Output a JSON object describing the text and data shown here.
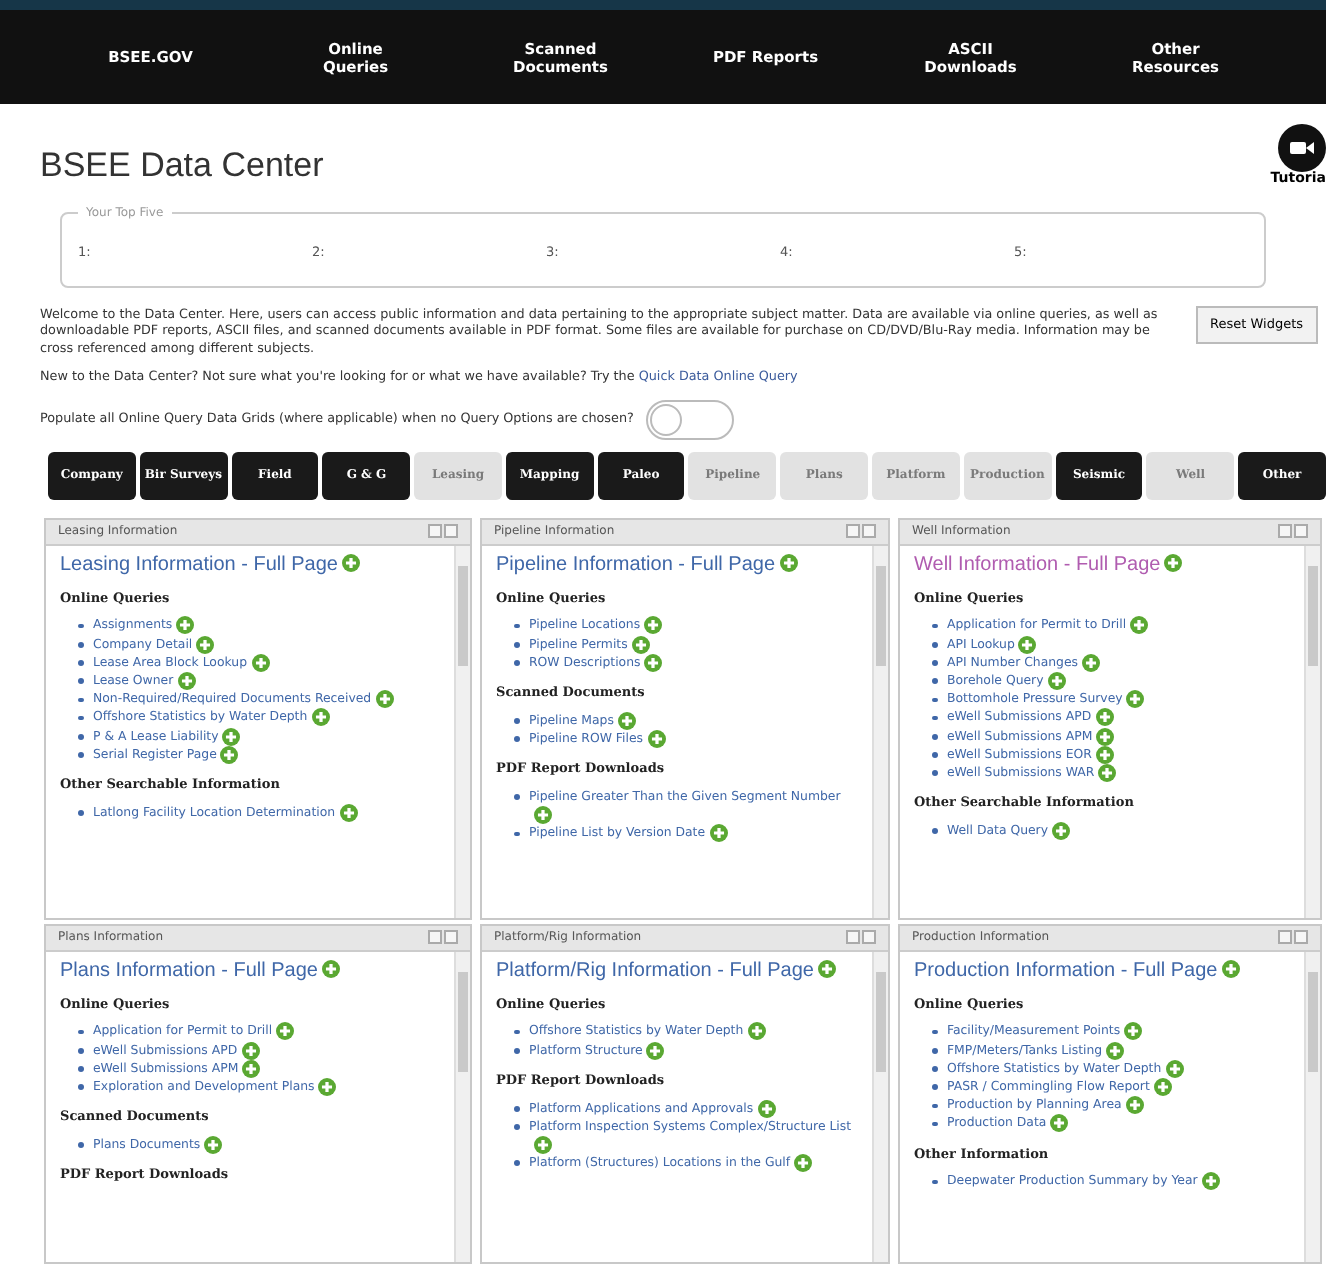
{
  "nav": [
    "BSEE.GOV",
    "Online Queries",
    "Scanned Documents",
    "PDF Reports",
    "ASCII Downloads",
    "Other Resources"
  ],
  "title": "BSEE Data Center",
  "tutorial": "Tutoria",
  "top_five": {
    "legend": "Your Top Five",
    "slots": [
      "1:",
      "2:",
      "3:",
      "4:",
      "5:"
    ]
  },
  "welcome": "Welcome to the Data Center. Here, users can access public information and data pertaining to the appropriate subject matter. Data are available via online queries, as well as downloadable PDF reports, ASCII files, and scanned documents available in PDF format. Some files are available for purchase on CD/DVD/Blu-Ray media. Information may be cross referenced among different subjects.",
  "reset_button": "Reset Widgets",
  "new_prompt": "New to the Data Center? Not sure what you're looking for or what we have available? Try the",
  "quick_link": "Quick Data Online Query",
  "populate": {
    "label": "Populate all Online Query Data Grids (where applicable) when no Query Options are chosen?",
    "on": false
  },
  "filters": [
    {
      "label": "Company",
      "disabled": false
    },
    {
      "label": "Bir Surveys",
      "disabled": false
    },
    {
      "label": "Field",
      "disabled": false
    },
    {
      "label": "G & G",
      "disabled": false
    },
    {
      "label": "Leasing",
      "disabled": true
    },
    {
      "label": "Mapping",
      "disabled": false
    },
    {
      "label": "Paleo",
      "disabled": false
    },
    {
      "label": "Pipeline",
      "disabled": true
    },
    {
      "label": "Plans",
      "disabled": true
    },
    {
      "label": "Platform",
      "disabled": true
    },
    {
      "label": "Production",
      "disabled": true
    },
    {
      "label": "Seismic",
      "disabled": false
    },
    {
      "label": "Well",
      "disabled": true
    },
    {
      "label": "Other",
      "disabled": false
    }
  ],
  "panels": [
    {
      "header": "Leasing Information",
      "full_page": "Leasing Information - Full Page",
      "selected": false,
      "sections": [
        {
          "heading": "Online Queries",
          "items": [
            "Assignments",
            "Company Detail",
            "Lease Area Block Lookup",
            "Lease Owner",
            "Non-Required/Required Documents Received",
            "Offshore Statistics by Water Depth",
            "P & A Lease Liability",
            "Serial Register Page"
          ]
        },
        {
          "heading": "Other Searchable Information",
          "items": [
            "Latlong Facility Location Determination"
          ]
        }
      ]
    },
    {
      "header": "Pipeline Information",
      "full_page": "Pipeline Information - Full Page",
      "selected": false,
      "sections": [
        {
          "heading": "Online Queries",
          "items": [
            "Pipeline Locations",
            "Pipeline Permits",
            "ROW Descriptions"
          ]
        },
        {
          "heading": "Scanned Documents",
          "items": [
            "Pipeline Maps",
            "Pipeline ROW Files"
          ]
        },
        {
          "heading": "PDF Report Downloads",
          "items": [
            "Pipeline Greater Than the Given Segment Number",
            "Pipeline List by Version Date"
          ]
        }
      ]
    },
    {
      "header": "Well Information",
      "full_page": "Well Information - Full Page",
      "selected": true,
      "sections": [
        {
          "heading": "Online Queries",
          "items": [
            "Application for Permit to Drill",
            "API Lookup",
            "API Number Changes",
            "Borehole Query",
            "Bottomhole Pressure Survey",
            "eWell Submissions APD",
            "eWell Submissions APM",
            "eWell Submissions EOR",
            "eWell Submissions WAR"
          ]
        },
        {
          "heading": "Other Searchable Information",
          "items": [
            "Well Data Query"
          ]
        }
      ]
    },
    {
      "header": "Plans Information",
      "full_page": "Plans Information - Full Page",
      "selected": false,
      "sections": [
        {
          "heading": "Online Queries",
          "items": [
            "Application for Permit to Drill",
            "eWell Submissions APD",
            "eWell Submissions APM",
            "Exploration and Development Plans"
          ]
        },
        {
          "heading": "Scanned Documents",
          "items": [
            "Plans Documents"
          ]
        },
        {
          "heading": "PDF Report Downloads"
        }
      ]
    },
    {
      "header": "Platform/Rig Information",
      "full_page": "Platform/Rig Information - Full Page",
      "selected": false,
      "sections": [
        {
          "heading": "Online Queries",
          "items": [
            "Offshore Statistics by Water Depth",
            "Platform Structure"
          ]
        },
        {
          "heading": "PDF Report Downloads",
          "items": [
            "Platform Applications and Approvals",
            "Platform Inspection Systems Complex/Structure List",
            "Platform (Structures) Locations in the Gulf"
          ]
        }
      ]
    },
    {
      "header": "Production Information",
      "full_page": "Production Information - Full Page",
      "selected": false,
      "sections": [
        {
          "heading": "Online Queries",
          "items": [
            "Facility/Measurement Points",
            "FMP/Meters/Tanks Listing",
            "Offshore Statistics by Water Depth",
            "PASR / Commingling Flow Report",
            "Production by Planning Area",
            "Production Data"
          ]
        },
        {
          "heading": "Other Information",
          "items": [
            "Deepwater Production Summary by Year"
          ]
        }
      ]
    }
  ]
}
